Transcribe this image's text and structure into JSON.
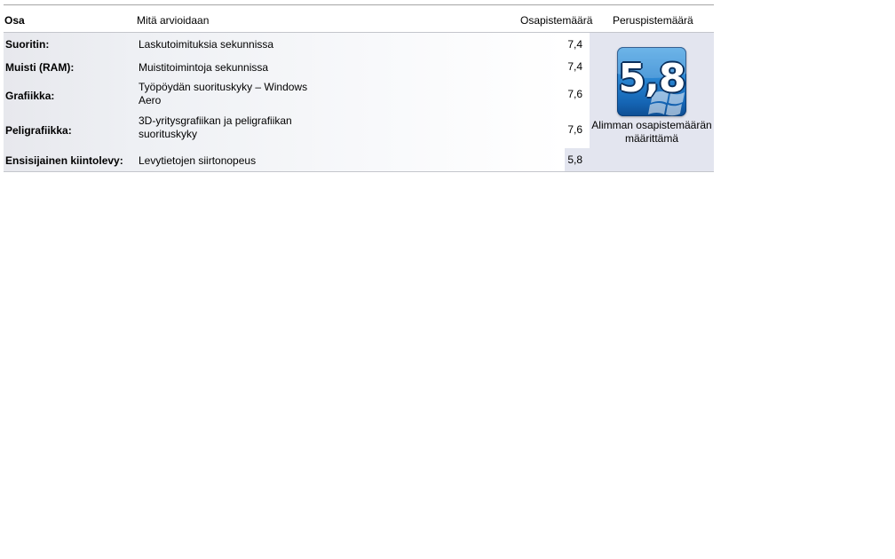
{
  "headers": {
    "component": "Osa",
    "rated": "Mitä arvioidaan",
    "subscore": "Osapistemäärä",
    "basescore": "Peruspistemäärä"
  },
  "rows": [
    {
      "component": "Suoritin:",
      "rated": "Laskutoimituksia sekunnissa",
      "subscore": "7,4"
    },
    {
      "component": "Muisti (RAM):",
      "rated": "Muistitoimintoja sekunnissa",
      "subscore": "7,4"
    },
    {
      "component": "Grafiikka:",
      "rated": "Työpöydän suorituskyky – Windows Aero",
      "subscore": "7,6"
    },
    {
      "component": "Peligrafiikka:",
      "rated": "3D-yritysgrafiikan ja peligrafiikan suorituskyky",
      "subscore": "7,6"
    },
    {
      "component": "Ensisijainen kiintolevy:",
      "rated": "Levytietojen siirtonopeus",
      "subscore": "5,8"
    }
  ],
  "base": {
    "score": "5,8",
    "caption": "Alimman osapistemäärän määrittämä"
  },
  "colors": {
    "badge": "#2a86d2",
    "panel": "#e3e5ef"
  },
  "icons": [
    "windows-logo-icon"
  ]
}
